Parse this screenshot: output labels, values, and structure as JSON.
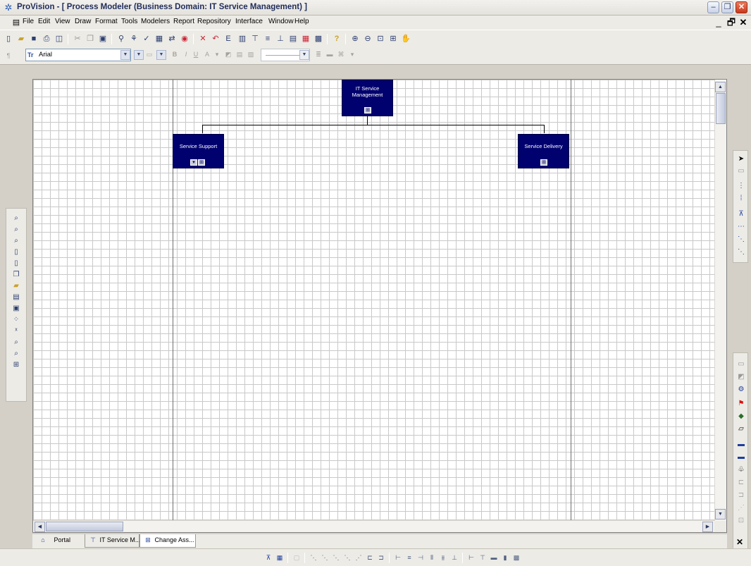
{
  "window": {
    "title": "ProVision - [ Process Modeler (Business Domain: IT Service Management) ]",
    "app_icon": "provision-app-icon"
  },
  "menubar": {
    "items": [
      "File",
      "Edit",
      "View",
      "Draw",
      "Format",
      "Tools",
      "Modelers",
      "Report",
      "Repository",
      "Interface",
      "Window",
      "Help"
    ]
  },
  "format_toolbar": {
    "font_name": "Arial"
  },
  "diagram": {
    "root": {
      "line1": "IT Service",
      "line2": "Management"
    },
    "children": [
      {
        "label": "Service Support"
      },
      {
        "label": "Service Delivery"
      }
    ],
    "box_color": "#00006e"
  },
  "tabs": [
    {
      "label": "Portal",
      "icon": "home-icon"
    },
    {
      "label": "IT Service M...",
      "icon": "hierarchy-icon"
    },
    {
      "label": "Change Ass...",
      "icon": "process-map-icon"
    }
  ]
}
